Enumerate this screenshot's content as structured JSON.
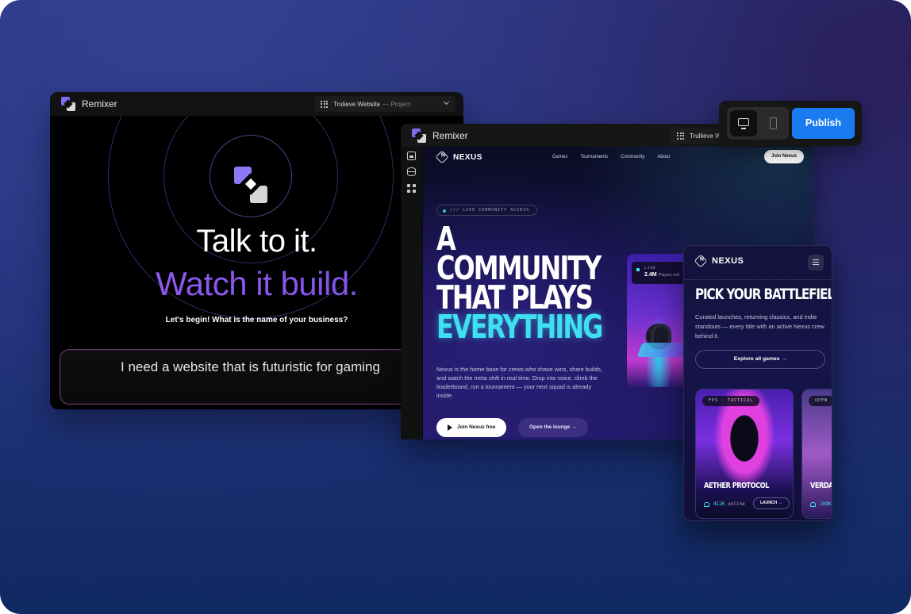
{
  "colors": {
    "accent_purple": "#8b4fe0",
    "publish_blue": "#1a7bf0",
    "neon_cyan": "#3ee0f0"
  },
  "chat_window": {
    "app_name": "Remixer",
    "project": {
      "name": "Trulieve Website",
      "suffix": "— Project"
    },
    "headline_1": "Talk to it.",
    "headline_2": "Watch it build.",
    "question": "Let's begin! What is the name of your business?",
    "input_value": "I need a website that is futuristic for gaming",
    "mic_icon": "microphone-icon"
  },
  "editor_window": {
    "app_name": "Remixer",
    "project": {
      "name": "Trullieve We"
    },
    "rail_icons": [
      "image-icon",
      "database-icon",
      "nodes-icon"
    ],
    "site": {
      "brand": "NEXUS",
      "nav": [
        "Games",
        "Tournaments",
        "Community",
        "About"
      ],
      "join_button": "Join Nexus",
      "access_pill": "/// LIVE COMMUNITY ACCESS",
      "headline_lines": [
        "A",
        "COMMUNITY",
        "THAT PLAYS"
      ],
      "headline_highlight": "EVERYTHING",
      "description": "Nexus is the home base for crews who chase wins, share builds, and watch the meta shift in real time. Drop into voice, climb the leaderboard, run a tournament — your next squad is already inside.",
      "cta_primary": "Join Nexus free",
      "cta_secondary": "Open the lounge →",
      "live_card": {
        "label": "LIVE",
        "count": "2.4M",
        "caption": "Players onli"
      }
    }
  },
  "mobile_preview": {
    "brand": "NEXUS",
    "title": "PICK YOUR BATTLEFIELD",
    "description": "Curated launches, returning classics, and indie standouts — every title with an active Nexus crew behind it.",
    "explore_button": "Explore all games →",
    "games": [
      {
        "tag": "FPS · TACTICAL",
        "title": "AETHER PROTOCOL",
        "online_count": "412K",
        "online_label": "online",
        "launch": "LAUNCH →"
      },
      {
        "tag": "OPEN",
        "title": "VERDA",
        "online_count": "289K",
        "online_label": "",
        "launch": ""
      }
    ]
  },
  "toolbar": {
    "desktop_icon": "desktop-monitor-icon",
    "mobile_icon": "mobile-phone-icon",
    "publish_label": "Publish",
    "selected_device": "desktop"
  }
}
